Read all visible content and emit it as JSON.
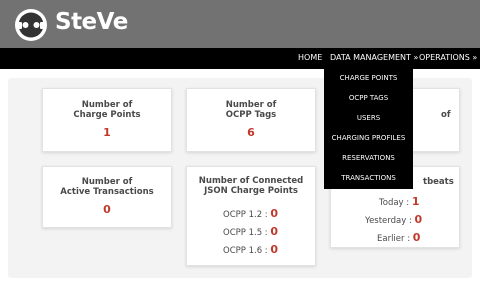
{
  "brand": {
    "name": "SteVe"
  },
  "nav": {
    "home": "HOME",
    "data_management": "DATA MANAGEMENT »",
    "operations": "OPERATIONS »"
  },
  "dropdown": {
    "items": [
      "CHARGE POINTS",
      "OCPP TAGS",
      "USERS",
      "CHARGING PROFILES",
      "RESERVATIONS",
      "TRANSACTIONS"
    ]
  },
  "cards": {
    "charge_points": {
      "title_line1": "Number of",
      "title_line2": "Charge Points",
      "value": "1"
    },
    "ocpp_tags": {
      "title_line1": "Number of",
      "title_line2": "OCPP Tags",
      "value": "6"
    },
    "users": {
      "title_partial": "of"
    },
    "active_transactions": {
      "title_line1": "Number of",
      "title_line2": "Active Transactions",
      "value": "0"
    },
    "connected_json": {
      "title_line1": "Number of Connected",
      "title_line2": "JSON Charge Points",
      "rows": [
        {
          "label": "OCPP 1.2 : ",
          "value": "0"
        },
        {
          "label": "OCPP 1.5 : ",
          "value": "0"
        },
        {
          "label": "OCPP 1.6 : ",
          "value": "0"
        }
      ]
    },
    "heartbeats": {
      "title_partial": "tbeats",
      "rows": [
        {
          "label": "Today : ",
          "value": "1"
        },
        {
          "label": "Yesterday : ",
          "value": "0"
        },
        {
          "label": "Earlier : ",
          "value": "0"
        }
      ]
    }
  },
  "colors": {
    "header": "#727272",
    "navbar": "#000000",
    "accent_value": "#c0392b"
  }
}
